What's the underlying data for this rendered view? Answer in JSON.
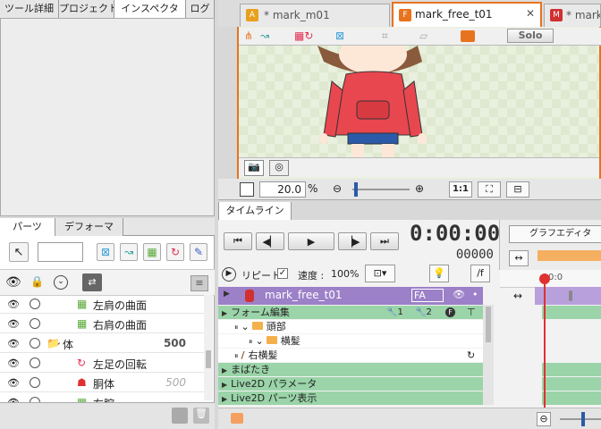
{
  "left_top_tabs": [
    "ツール詳細",
    "プロジェクト",
    "インスペクタ",
    "ログ"
  ],
  "doc_tabs": [
    {
      "badge": "A",
      "label": "* mark_m01"
    },
    {
      "badge": "F",
      "label": "mark_free_t01"
    },
    {
      "badge": "M",
      "label": "* mark"
    }
  ],
  "canvas_toolbar": {
    "solo": "Solo"
  },
  "zoom": {
    "value": "20.0",
    "unit": "%",
    "ratio_btn": "1:1"
  },
  "parts_tabs": [
    "パーツ",
    "デフォーマ"
  ],
  "parts_rows": [
    {
      "label": "左肩の曲面",
      "icon": "grid-icon",
      "num": "",
      "indent": 104
    },
    {
      "label": "右肩の曲面",
      "icon": "grid-icon",
      "num": "",
      "indent": 104
    },
    {
      "label": "体",
      "icon": "folder-icon",
      "num": "500",
      "indent": 70
    },
    {
      "label": "左足の回転",
      "icon": "rotation-icon",
      "num": "",
      "indent": 104
    },
    {
      "label": "胴体",
      "icon": "body-icon",
      "num": "500",
      "indent": 104
    },
    {
      "label": "右腕",
      "icon": "grid-icon",
      "num": "",
      "indent": 104
    }
  ],
  "timeline": {
    "tab": "タイムライン",
    "time": "0:00:00",
    "frame": "00000",
    "repeat_label": "リピート",
    "speed_label": "速度 :",
    "speed_value": "100%",
    "fx_btn": "/f",
    "graph_editor": "グラフエディタ",
    "ruler_start": "0:0",
    "scene": {
      "name": "mark_free_t01",
      "badge": "FA"
    },
    "rows": [
      {
        "label": "フォーム編集",
        "style": "group"
      },
      {
        "label": "頭部",
        "style": "folder"
      },
      {
        "label": "横髪",
        "style": "folder2"
      },
      {
        "label": "右横髪",
        "style": "art"
      },
      {
        "label": "まばたき",
        "style": "group"
      },
      {
        "label": "Live2D パラメータ",
        "style": "group"
      },
      {
        "label": "Live2D パーツ表示",
        "style": "group"
      }
    ],
    "form_icons": [
      "1",
      "2"
    ]
  },
  "colors": {
    "accent": "#e8731e",
    "scene_purple": "#9c80c8",
    "track_green": "#9ad4a8",
    "playhead": "#e03030"
  }
}
